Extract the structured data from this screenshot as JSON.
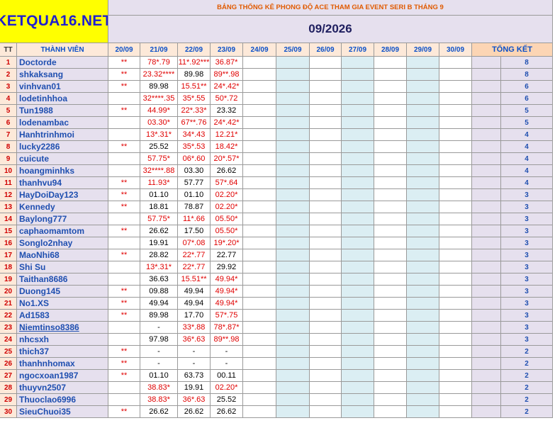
{
  "logo": "KETQUA16.NET",
  "title": "BẢNG THỐNG KÊ PHONG ĐỘ ACE THAM GIA EVENT SERI B THÁNG 9",
  "month": "09/2026",
  "headers": {
    "tt": "TT",
    "member": "THÀNH VIÊN",
    "dates": [
      "20/09",
      "21/09",
      "22/09",
      "23/09",
      "24/09",
      "25/09",
      "26/09",
      "27/09",
      "28/09",
      "29/09",
      "30/09"
    ],
    "total": "TỔNG KẾT"
  },
  "rows": [
    {
      "tt": "1",
      "name": "Doctorde",
      "cells": [
        "**",
        "78*.79",
        "11*.92***",
        "36.87*"
      ],
      "total": "8"
    },
    {
      "tt": "2",
      "name": "shkaksang",
      "cells": [
        "**",
        "23.32****",
        "89.98",
        "89**.98"
      ],
      "total": "8"
    },
    {
      "tt": "3",
      "name": "vinhvan01",
      "cells": [
        "**",
        "89.98",
        "15.51**",
        "24*.42*"
      ],
      "total": "6"
    },
    {
      "tt": "4",
      "name": "lodetinhhoa",
      "cells": [
        "",
        "32****.35",
        "35*.55",
        "50*.72"
      ],
      "total": "6"
    },
    {
      "tt": "5",
      "name": "Tun1988",
      "cells": [
        "**",
        "44.99*",
        "22*.33*",
        "23.32"
      ],
      "total": "5"
    },
    {
      "tt": "6",
      "name": "lodenambac",
      "cells": [
        "",
        "03.30*",
        "67**.76",
        "24*.42*"
      ],
      "total": "5"
    },
    {
      "tt": "7",
      "name": "Hanhtrinhmoi",
      "cells": [
        "",
        "13*.31*",
        "34*.43",
        "12.21*"
      ],
      "total": "4"
    },
    {
      "tt": "8",
      "name": "lucky2286",
      "cells": [
        "**",
        "25.52",
        "35*.53",
        "18.42*"
      ],
      "total": "4"
    },
    {
      "tt": "9",
      "name": "cuicute",
      "cells": [
        "",
        "57.75*",
        "06*.60",
        "20*.57*"
      ],
      "total": "4"
    },
    {
      "tt": "10",
      "name": "hoangminhks",
      "cells": [
        "",
        "32****.88",
        "03.30",
        "26.62"
      ],
      "total": "4"
    },
    {
      "tt": "11",
      "name": "thanhvu94",
      "cells": [
        "**",
        "11.93*",
        "57.77",
        "57*.64"
      ],
      "total": "4"
    },
    {
      "tt": "12",
      "name": "HayDoiDay123",
      "cells": [
        "**",
        "01.10",
        "01.10",
        "02.20*"
      ],
      "total": "3"
    },
    {
      "tt": "13",
      "name": "Kennedy",
      "cells": [
        "**",
        "18.81",
        "78.87",
        "02.20*"
      ],
      "total": "3"
    },
    {
      "tt": "14",
      "name": "Baylong777",
      "cells": [
        "",
        "57.75*",
        "11*.66",
        "05.50*"
      ],
      "total": "3"
    },
    {
      "tt": "15",
      "name": "caphaomamtom",
      "cells": [
        "**",
        "26.62",
        "17.50",
        "05.50*"
      ],
      "total": "3"
    },
    {
      "tt": "16",
      "name": "Songlo2nhay",
      "cells": [
        "",
        "19.91",
        "07*.08",
        "19*.20*"
      ],
      "total": "3"
    },
    {
      "tt": "17",
      "name": "MaoNhi68",
      "cells": [
        "**",
        "28.82",
        "22*.77",
        "22.77"
      ],
      "total": "3"
    },
    {
      "tt": "18",
      "name": "Shi Su",
      "cells": [
        "",
        "13*.31*",
        "22*.77",
        "29.92"
      ],
      "total": "3"
    },
    {
      "tt": "19",
      "name": "Taithan8686",
      "cells": [
        "",
        "36.63",
        "15.51**",
        "49.94*"
      ],
      "total": "3"
    },
    {
      "tt": "20",
      "name": "Duong145",
      "cells": [
        "**",
        "09.88",
        "49.94",
        "49.94*"
      ],
      "total": "3"
    },
    {
      "tt": "21",
      "name": "No1.XS",
      "cells": [
        "**",
        "49.94",
        "49.94",
        "49.94*"
      ],
      "total": "3"
    },
    {
      "tt": "22",
      "name": "Ad1583",
      "cells": [
        "**",
        "89.98",
        "17.70",
        "57*.75"
      ],
      "total": "3"
    },
    {
      "tt": "23",
      "name": "Niemtinso8386",
      "cells": [
        "",
        "-",
        "33*.88",
        "78*.87*"
      ],
      "total": "3",
      "underline": true
    },
    {
      "tt": "24",
      "name": "nhcsxh",
      "cells": [
        "",
        "97.98",
        "36*.63",
        "89**.98"
      ],
      "total": "3"
    },
    {
      "tt": "25",
      "name": "thich37",
      "cells": [
        "**",
        "-",
        "-",
        "-"
      ],
      "total": "2"
    },
    {
      "tt": "26",
      "name": "thanhnhomax",
      "cells": [
        "**",
        "-",
        "-",
        "-"
      ],
      "total": "2"
    },
    {
      "tt": "27",
      "name": "ngocxoan1987",
      "cells": [
        "**",
        "01.10",
        "63.73",
        "00.11"
      ],
      "total": "2"
    },
    {
      "tt": "28",
      "name": "thuyvn2507",
      "cells": [
        "",
        "38.83*",
        "19.91",
        "02.20*"
      ],
      "total": "2"
    },
    {
      "tt": "29",
      "name": "Thuoclao6996",
      "cells": [
        "",
        "38.83*",
        "36*.63",
        "25.52"
      ],
      "total": "2"
    },
    {
      "tt": "30",
      "name": "SieuChuoi35",
      "cells": [
        "**",
        "26.62",
        "26.62",
        "26.62"
      ],
      "total": "2"
    }
  ],
  "colors": {
    "logo_bg": "#ffff00",
    "logo_text": "#1f1fd0",
    "title_text": "#e05a00",
    "hit": "#e00000",
    "name_text": "#1f4fb0",
    "empty_blue": "#dbeef3"
  }
}
